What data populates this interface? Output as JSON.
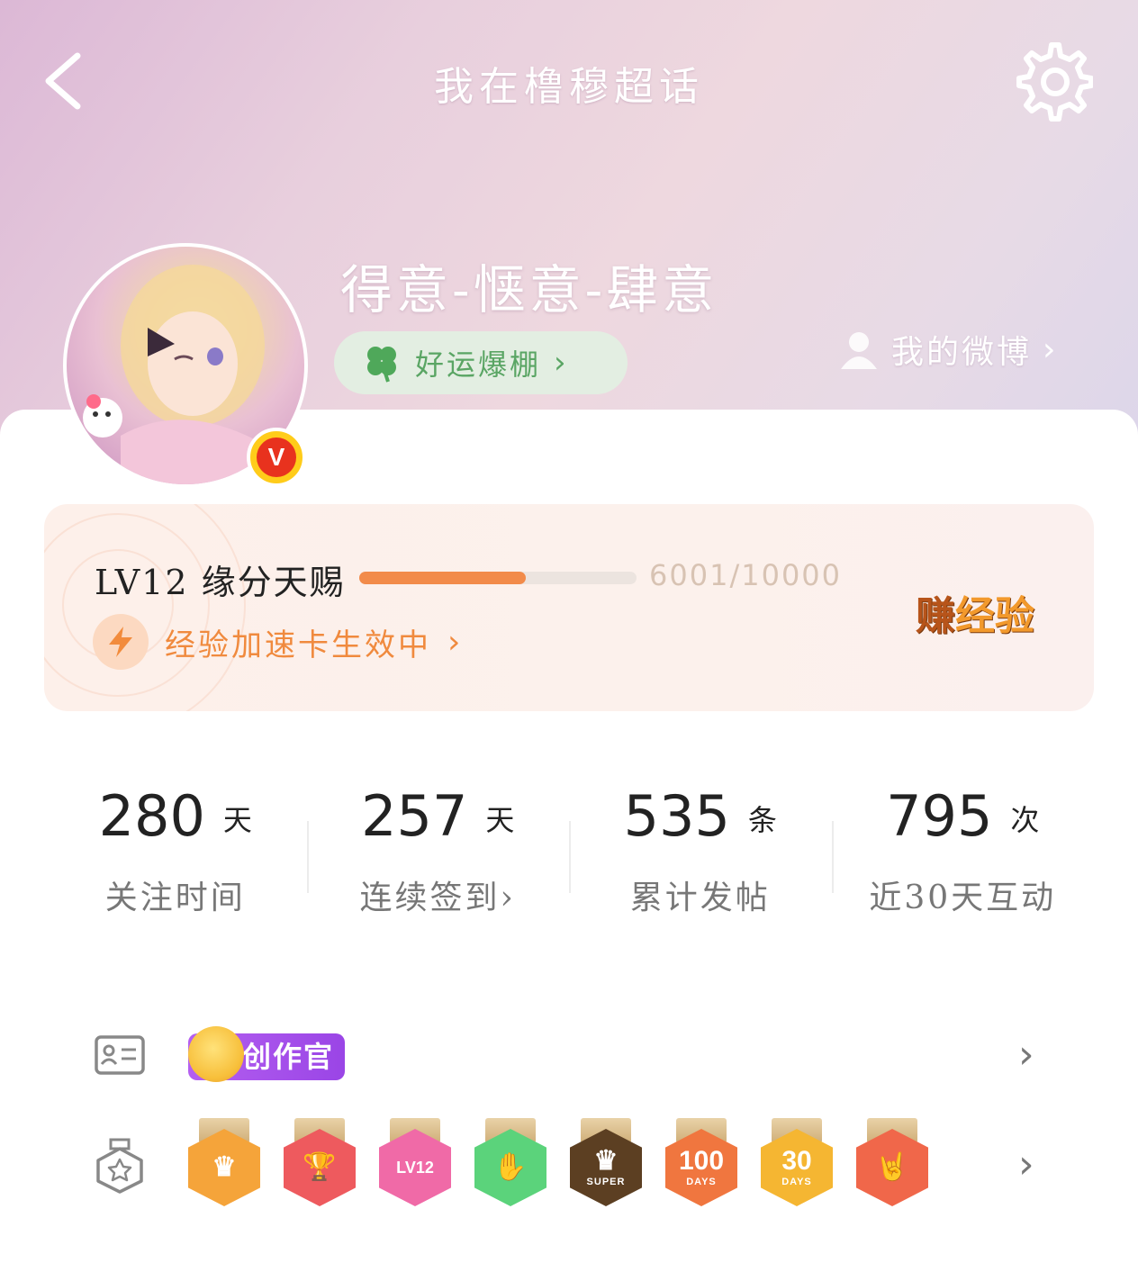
{
  "header": {
    "title": "我在橹穆超话",
    "back_icon": "chevron-left-icon",
    "settings_icon": "gear-icon"
  },
  "profile": {
    "nickname": "得意-惬意-肆意",
    "verified_badge": "V",
    "luck_tag": "好运爆棚",
    "luck_icon": "clover-icon",
    "my_weibo_label": "我的微博",
    "my_weibo_icon": "user-icon"
  },
  "level": {
    "label": "LV12 缘分天赐",
    "exp_text": "6001/10000",
    "progress": 0.6001,
    "boost_text": "经验加速卡生效中",
    "boost_icon": "lightning-icon",
    "earn_a": "赚",
    "earn_b": "经验"
  },
  "stats": [
    {
      "value": "280",
      "unit": "天",
      "label": "关注时间",
      "chev": ""
    },
    {
      "value": "257",
      "unit": "天",
      "label": "连续签到",
      "chev": "›"
    },
    {
      "value": "535",
      "unit": "条",
      "label": "累计发帖",
      "chev": ""
    },
    {
      "value": "795",
      "unit": "次",
      "label": "近30天互动",
      "chev": ""
    }
  ],
  "identity": {
    "icon": "id-card-icon",
    "tag": "创作官"
  },
  "medals": {
    "icon": "medal-icon",
    "items": [
      {
        "name": "crown-medal",
        "glyph": "♛",
        "sub": "",
        "color": "#f5a43a"
      },
      {
        "name": "trophy-medal",
        "glyph": "🏆",
        "sub": "",
        "color": "#ee5a5e"
      },
      {
        "name": "lv12-medal",
        "glyph": "LV12",
        "sub": "",
        "color": "#f06aa7"
      },
      {
        "name": "hand-medal",
        "glyph": "✋",
        "sub": "",
        "color": "#5bd37b"
      },
      {
        "name": "super-medal",
        "glyph": "♛",
        "sub": "SUPER",
        "color": "#5c3f22"
      },
      {
        "name": "100-days-medal",
        "glyph": "100",
        "sub": "DAYS",
        "color": "#f0763f"
      },
      {
        "name": "30-days-medal",
        "glyph": "30",
        "sub": "DAYS",
        "color": "#f5b632"
      },
      {
        "name": "rock-hand-medal",
        "glyph": "🤘",
        "sub": "",
        "color": "#f0674a"
      }
    ]
  }
}
